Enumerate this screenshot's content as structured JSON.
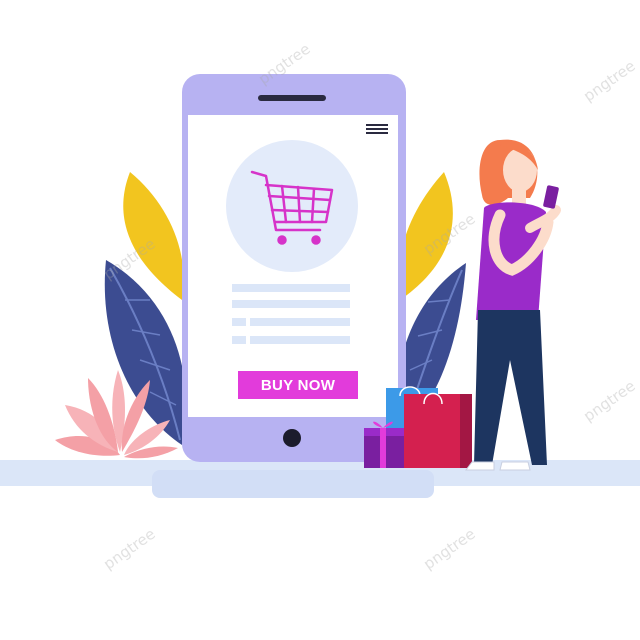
{
  "phone": {
    "button_label": "BUY NOW"
  },
  "watermark": {
    "logo_text": "pngtree"
  },
  "colors": {
    "phone_frame": "#b7b2f2",
    "screen": "#ffffff",
    "cart": "#d633c9",
    "cart_circle": "#e3ebfa",
    "button": "#e23bdb",
    "ground": "#dbe6f8",
    "leaf_yellow": "#f2c51f",
    "leaf_blue": "#3c4c91",
    "plant_pink": "#f4a0a6",
    "shirt": "#9a2bc9",
    "hair": "#f47b4d",
    "pants": "#1d3560",
    "bag_red": "#d4204f",
    "bag_blue": "#3c9ae8",
    "gift": "#7a1fa0"
  },
  "icons": {
    "cart": "shopping-cart-icon",
    "menu": "hamburger-menu-icon"
  }
}
